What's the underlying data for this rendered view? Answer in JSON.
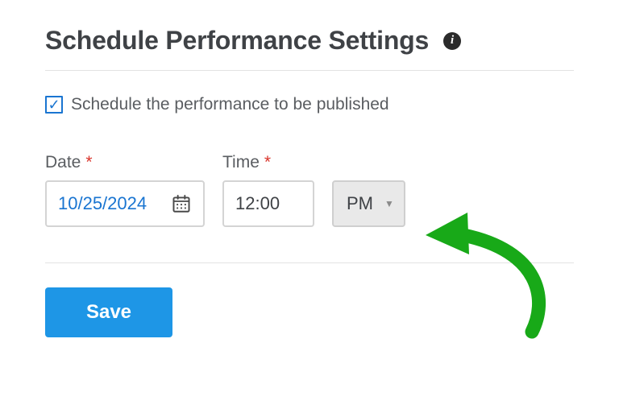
{
  "title": "Schedule Performance Settings",
  "checkbox_label": "Schedule the performance to be published",
  "checkbox_checked": "✓",
  "date_label": "Date",
  "date_value": "10/25/2024",
  "time_label": "Time",
  "time_value": "12:00",
  "ampm_value": "PM",
  "required_mark": "*",
  "save_label": "Save"
}
